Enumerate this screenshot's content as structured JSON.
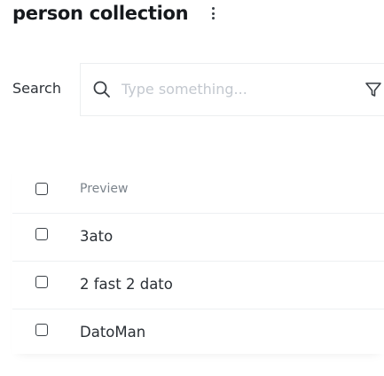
{
  "header": {
    "title": "person collection",
    "menu_icon": "more-vertical-icon"
  },
  "search": {
    "label": "Search",
    "placeholder": "Type something...",
    "value": "",
    "search_icon": "search-icon",
    "filter_icon": "filter-icon"
  },
  "table": {
    "columns": [
      "Preview"
    ],
    "rows": [
      {
        "preview": "3ato",
        "checked": false
      },
      {
        "preview": "2 fast 2 dato",
        "checked": false
      },
      {
        "preview": "DatoMan",
        "checked": false
      }
    ]
  }
}
